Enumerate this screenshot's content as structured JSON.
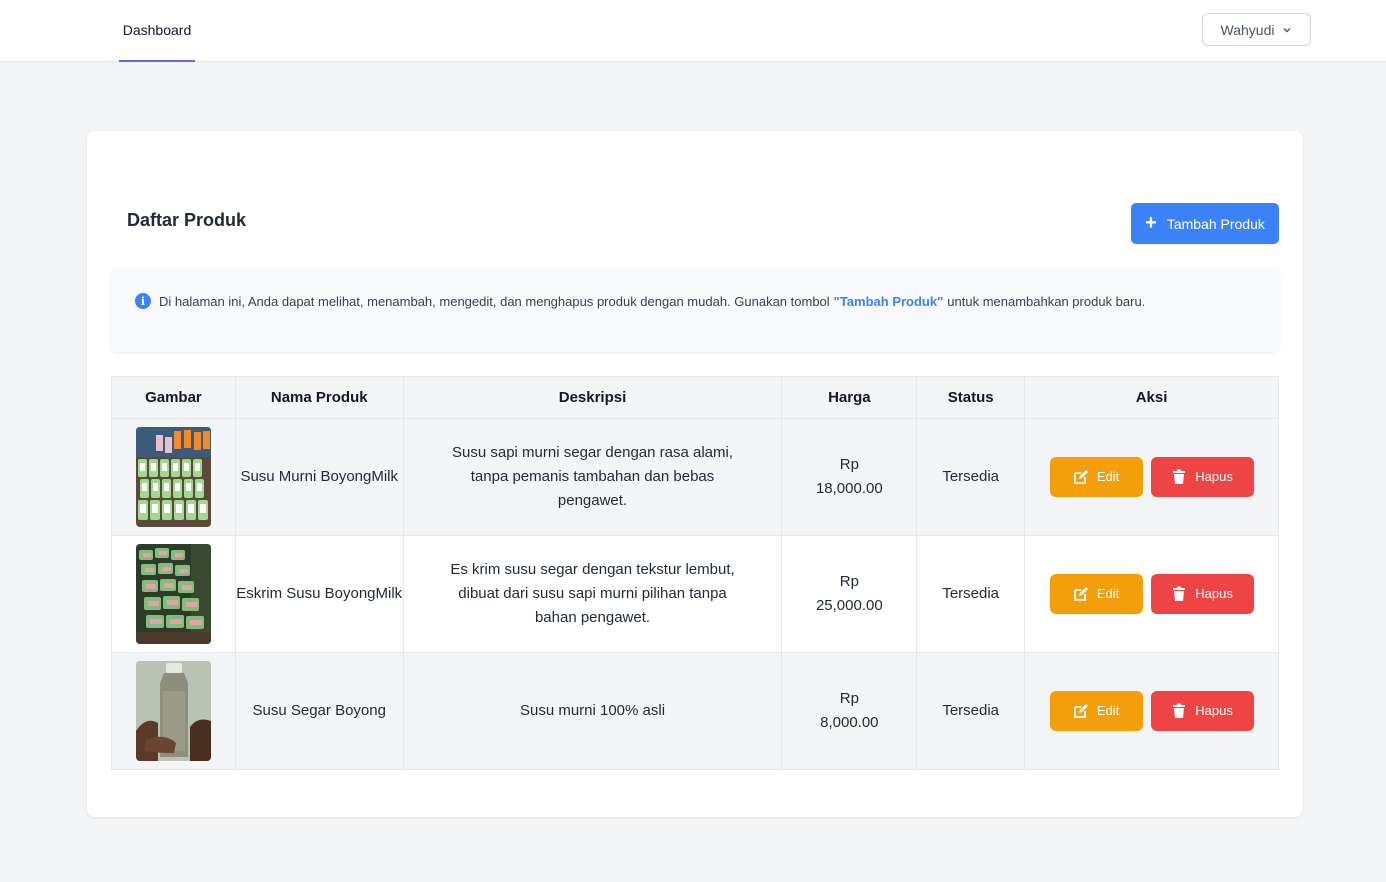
{
  "nav": {
    "dashboard": "Dashboard",
    "user": "Wahyudi"
  },
  "page": {
    "title": "Daftar Produk",
    "add_button": "Tambah Produk",
    "info_prefix": "Di halaman ini, Anda dapat melihat, menambah, mengedit, dan menghapus produk dengan mudah. Gunakan tombol",
    "info_highlight": "\"Tambah Produk\"",
    "info_suffix": "untuk menambahkan produk baru."
  },
  "table": {
    "headers": [
      "Gambar",
      "Nama Produk",
      "Deskripsi",
      "Harga",
      "Status",
      "Aksi"
    ],
    "edit_label": "Edit",
    "delete_label": "Hapus",
    "rows": [
      {
        "name": "Susu Murni BoyongMilk",
        "description": "Susu sapi murni segar dengan rasa alami, tanpa pemanis tambahan dan bebas pengawet.",
        "price_currency": "Rp",
        "price_value": "18,000.00",
        "status": "Tersedia"
      },
      {
        "name": "Eskrim Susu BoyongMilk",
        "description": "Es krim susu segar dengan tekstur lembut, dibuat dari susu sapi murni pilihan tanpa bahan pengawet.",
        "price_currency": "Rp",
        "price_value": "25,000.00",
        "status": "Tersedia"
      },
      {
        "name": "Susu Segar Boyong",
        "description": "Susu murni 100% asli",
        "price_currency": "Rp",
        "price_value": "8,000.00",
        "status": "Tersedia"
      }
    ]
  },
  "colors": {
    "primary": "#3b82f6",
    "nav_active": "#6366f1",
    "edit": "#f59e0b",
    "delete": "#ef4444"
  },
  "icons": {
    "add": "plus-icon",
    "info": "info-circle-icon",
    "edit": "edit-icon",
    "delete": "trash-icon",
    "dropdown": "chevron-down-icon"
  }
}
